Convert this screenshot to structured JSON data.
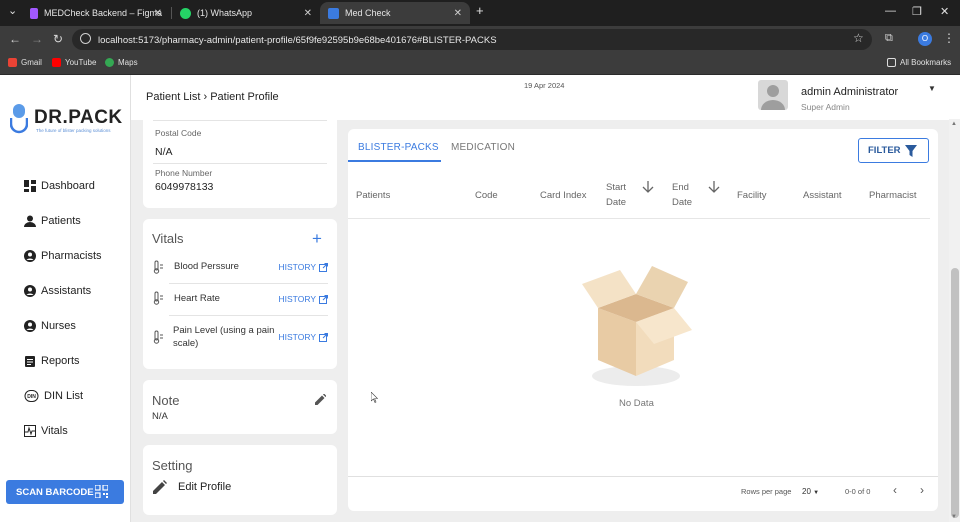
{
  "browser": {
    "tabs": [
      {
        "title": "MEDCheck Backend – Figma",
        "icon_color": "#a259ff"
      },
      {
        "title": "(1) WhatsApp",
        "icon_color": "#25d366"
      },
      {
        "title": "Med Check",
        "icon_color": "#3b7be0"
      }
    ],
    "url": "localhost:5173/pharmacy-admin/patient-profile/65f9fe92595b9e68be401676#BLISTER-PACKS",
    "bookmarks": [
      "Gmail",
      "YouTube",
      "Maps"
    ],
    "all_bookmarks": "All Bookmarks",
    "profile_initial": "O"
  },
  "app": {
    "logo": {
      "name": "DR.PACK",
      "tagline": "The future of blister packing solutions"
    },
    "nav": [
      {
        "label": "Dashboard",
        "icon": "dashboard-icon"
      },
      {
        "label": "Patients",
        "icon": "patient-icon"
      },
      {
        "label": "Pharmacists",
        "icon": "pharmacist-icon"
      },
      {
        "label": "Assistants",
        "icon": "assistant-icon"
      },
      {
        "label": "Nurses",
        "icon": "nurse-icon"
      },
      {
        "label": "Reports",
        "icon": "reports-icon"
      },
      {
        "label": "DIN List",
        "icon": "din-icon"
      },
      {
        "label": "Vitals",
        "icon": "vitals-icon"
      }
    ],
    "scan_barcode": "SCAN BARCODE",
    "accent": "#3b7be0"
  },
  "header": {
    "breadcrumb": "Patient List › Patient Profile",
    "date": "19 Apr 2024",
    "user_name": "admin Administrator",
    "user_role": "Super Admin"
  },
  "profile": {
    "postal_label": "Postal Code",
    "postal_value": "N/A",
    "phone_label": "Phone Number",
    "phone_value": "6049978133"
  },
  "vitals": {
    "title": "Vitals",
    "items": [
      {
        "label": "Blood Perssure",
        "action": "HISTORY"
      },
      {
        "label": "Heart Rate",
        "action": "HISTORY"
      },
      {
        "label": "Pain Level (using a pain scale)",
        "action": "HISTORY"
      }
    ]
  },
  "note": {
    "title": "Note",
    "value": "N/A"
  },
  "setting": {
    "title": "Setting",
    "edit_profile": "Edit Profile"
  },
  "main": {
    "tabs": [
      "BLISTER-PACKS",
      "MEDICATION"
    ],
    "filter": "FILTER",
    "columns": [
      "Patients",
      "Code",
      "Card Index",
      "Start Date",
      "End Date",
      "Facility",
      "Assistant",
      "Pharmacist"
    ],
    "empty": "No Data",
    "rows_per_page_label": "Rows per page",
    "rows_per_page": "20",
    "range": "0-0 of 0"
  }
}
